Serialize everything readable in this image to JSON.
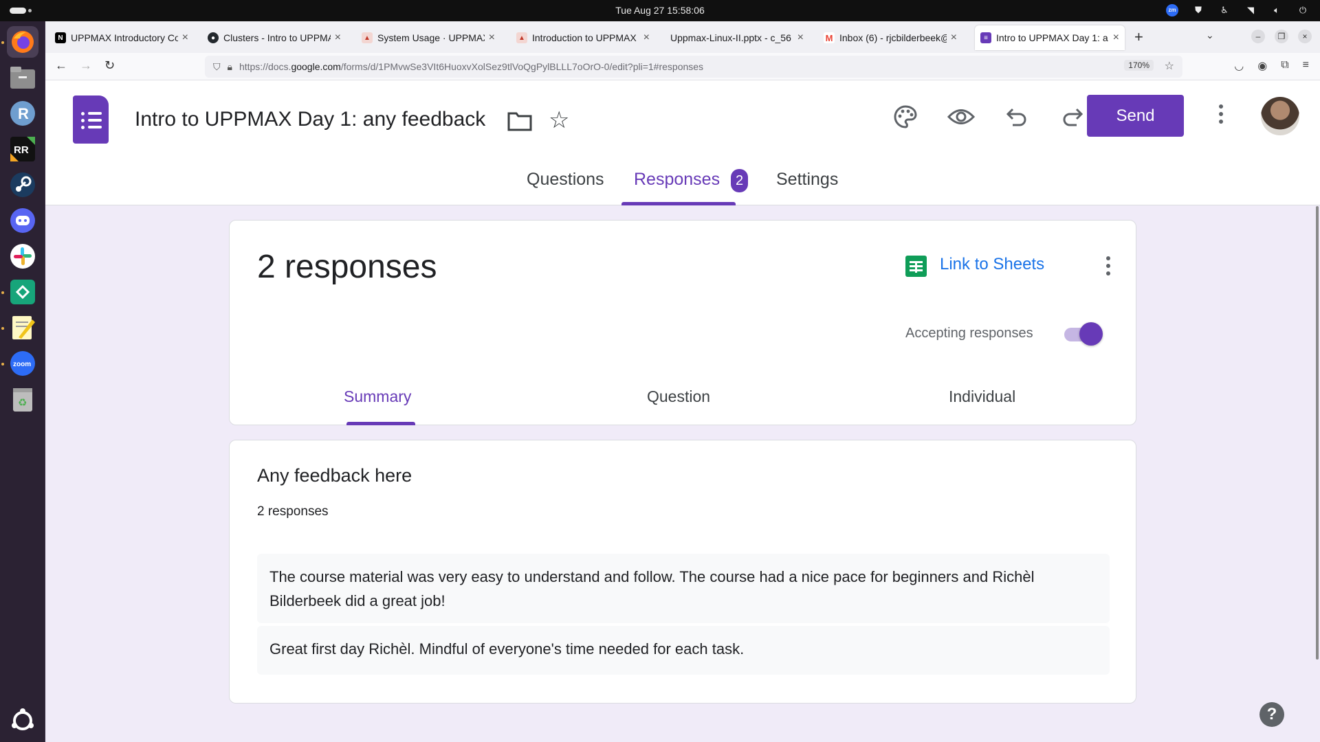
{
  "system": {
    "clock": "Tue Aug 27  15:58:06",
    "tray_zoom_label": "zm"
  },
  "browser": {
    "tabs": [
      {
        "title": "UPPMAX Introductory Co",
        "favicon": "notion-icon",
        "color": "#000000"
      },
      {
        "title": "Clusters - Intro to UPPMA",
        "favicon": "github-icon",
        "color": "#24292e"
      },
      {
        "title": "System Usage · UPPMAX",
        "favicon": "uppmax-icon",
        "color": "#c0392b"
      },
      {
        "title": "Introduction to UPPMAX",
        "favicon": "uppmax-icon",
        "color": "#c0392b"
      },
      {
        "title": "Uppmax-Linux-II.pptx - c_56",
        "favicon": "none",
        "color": "#ffffff"
      },
      {
        "title": "Inbox (6) - rjcbilderbeek@",
        "favicon": "gmail-icon",
        "color": "#ea4335"
      },
      {
        "title": "Intro to UPPMAX Day 1: a",
        "favicon": "forms-icon",
        "color": "#673ab7"
      }
    ],
    "url": {
      "prefix": "https://docs.",
      "host": "google.com",
      "path": "/forms/d/1PMvwSe3VIt6HuoxvXolSez9tlVoQgPylBLLL7oOrO-0/edit?pli=1#responses"
    },
    "zoom": "170%"
  },
  "form": {
    "title": "Intro to UPPMAX Day 1: any feedback",
    "send_label": "Send",
    "tabs": {
      "questions": "Questions",
      "responses": "Responses",
      "responses_badge": "2",
      "settings": "Settings"
    }
  },
  "summary_card": {
    "response_count": "2 responses",
    "link_sheets": "Link to Sheets",
    "accepting_label": "Accepting responses",
    "accepting": true,
    "subtabs": [
      "Summary",
      "Question",
      "Individual"
    ]
  },
  "question_card": {
    "title": "Any feedback here",
    "count": "2 responses",
    "answers": [
      "The course material was very easy to understand and follow. The course had a nice pace for beginners and Richèl Bilderbeek did a great job!",
      "Great first day Richèl. Mindful of everyone's time needed for each task."
    ]
  },
  "colors": {
    "accent": "#673ab7",
    "link": "#1a73e8",
    "page_bg": "#f0ebf8",
    "sheets_green": "#0f9d58"
  },
  "help_label": "?"
}
